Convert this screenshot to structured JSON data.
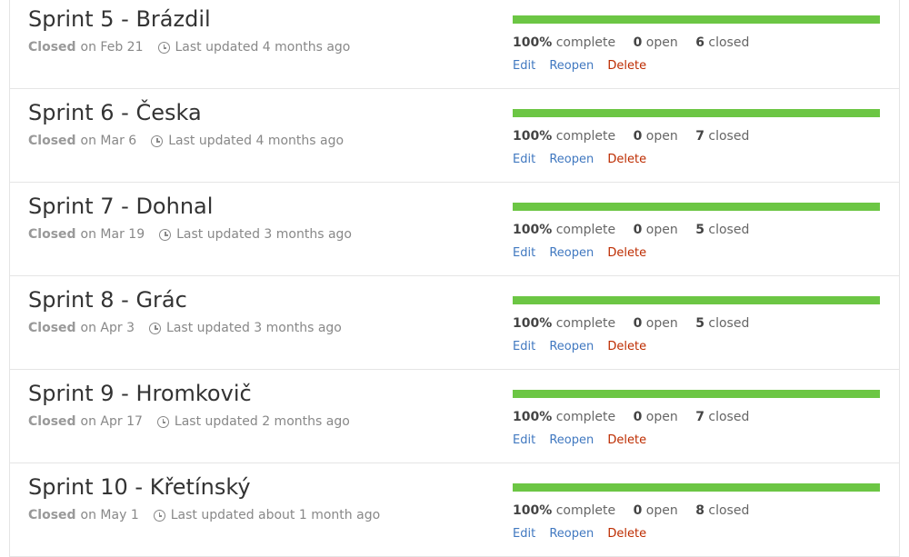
{
  "colors": {
    "progress_fill": "#6cc644",
    "link": "#4078c0",
    "danger": "#bd2c00"
  },
  "labels": {
    "closed": "Closed",
    "complete": "complete",
    "open": "open",
    "closed_count": "closed",
    "edit": "Edit",
    "reopen": "Reopen",
    "delete": "Delete"
  },
  "milestones": [
    {
      "title": "Sprint 5 - Brázdil",
      "closed_on": "on Feb 21",
      "updated": "Last updated 4 months ago",
      "percent": "100%",
      "progress": 1.0,
      "open": "0",
      "closed": "6"
    },
    {
      "title": "Sprint 6 - Česka",
      "closed_on": "on Mar 6",
      "updated": "Last updated 4 months ago",
      "percent": "100%",
      "progress": 1.0,
      "open": "0",
      "closed": "7"
    },
    {
      "title": "Sprint 7 - Dohnal",
      "closed_on": "on Mar 19",
      "updated": "Last updated 3 months ago",
      "percent": "100%",
      "progress": 1.0,
      "open": "0",
      "closed": "5"
    },
    {
      "title": "Sprint 8 - Grác",
      "closed_on": "on Apr 3",
      "updated": "Last updated 3 months ago",
      "percent": "100%",
      "progress": 1.0,
      "open": "0",
      "closed": "5"
    },
    {
      "title": "Sprint 9 - Hromkovič",
      "closed_on": "on Apr 17",
      "updated": "Last updated 2 months ago",
      "percent": "100%",
      "progress": 1.0,
      "open": "0",
      "closed": "7"
    },
    {
      "title": "Sprint 10 - Křetínský",
      "closed_on": "on May 1",
      "updated": "Last updated about 1 month ago",
      "percent": "100%",
      "progress": 1.0,
      "open": "0",
      "closed": "8"
    }
  ]
}
